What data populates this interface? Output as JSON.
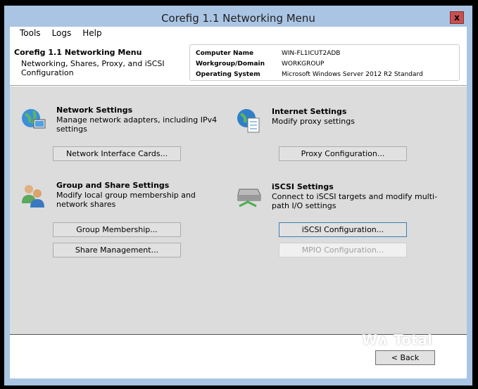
{
  "window": {
    "title": "Corefig 1.1 Networking Menu",
    "close": "x"
  },
  "menu": [
    "Tools",
    "Logs",
    "Help"
  ],
  "header": {
    "title": "Corefig 1.1 Networking Menu",
    "subtitle": "Networking, Shares, Proxy, and iSCSI Configuration",
    "info": [
      {
        "k": "Computer Name",
        "v": "WIN-FL1ICUT2ADB"
      },
      {
        "k": "Workgroup/Domain",
        "v": "WORKGROUP"
      },
      {
        "k": "Operating System",
        "v": "Microsoft Windows Server 2012 R2 Standard"
      }
    ]
  },
  "sections": {
    "network": {
      "title": "Network Settings",
      "desc": "Manage network adapters, including IPv4 settings",
      "btn": "Network Interface Cards..."
    },
    "internet": {
      "title": "Internet Settings",
      "desc": "Modify proxy settings",
      "btn": "Proxy Configuration..."
    },
    "group": {
      "title": "Group and Share Settings",
      "desc": "Modify local group membership and network shares",
      "btn1": "Group Membership...",
      "btn2": "Share Management..."
    },
    "iscsi": {
      "title": "iSCSI Settings",
      "desc": "Connect to iSCSI targets and modify multi-path I/O settings",
      "btn1": "iSCSI Configuration...",
      "btn2": "MPIO Configuration..."
    }
  },
  "footer": {
    "back": "< Back",
    "watermark": "WinTotal"
  }
}
